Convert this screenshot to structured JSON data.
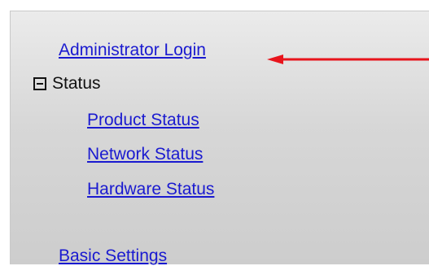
{
  "nav": {
    "admin_login": "Administrator Login",
    "status_section": {
      "label": "Status",
      "expanded": true,
      "toggle_icon": "minus-box-icon",
      "items": [
        {
          "label": "Product Status"
        },
        {
          "label": "Network Status"
        },
        {
          "label": "Hardware Status"
        }
      ]
    },
    "basic_settings": "Basic Settings"
  },
  "annotation": {
    "icon": "red-arrow-icon",
    "color": "#e8141c"
  },
  "colors": {
    "link": "#1a1ad0",
    "panel_top": "#ebebeb",
    "panel_bottom": "#cdcdcd"
  }
}
